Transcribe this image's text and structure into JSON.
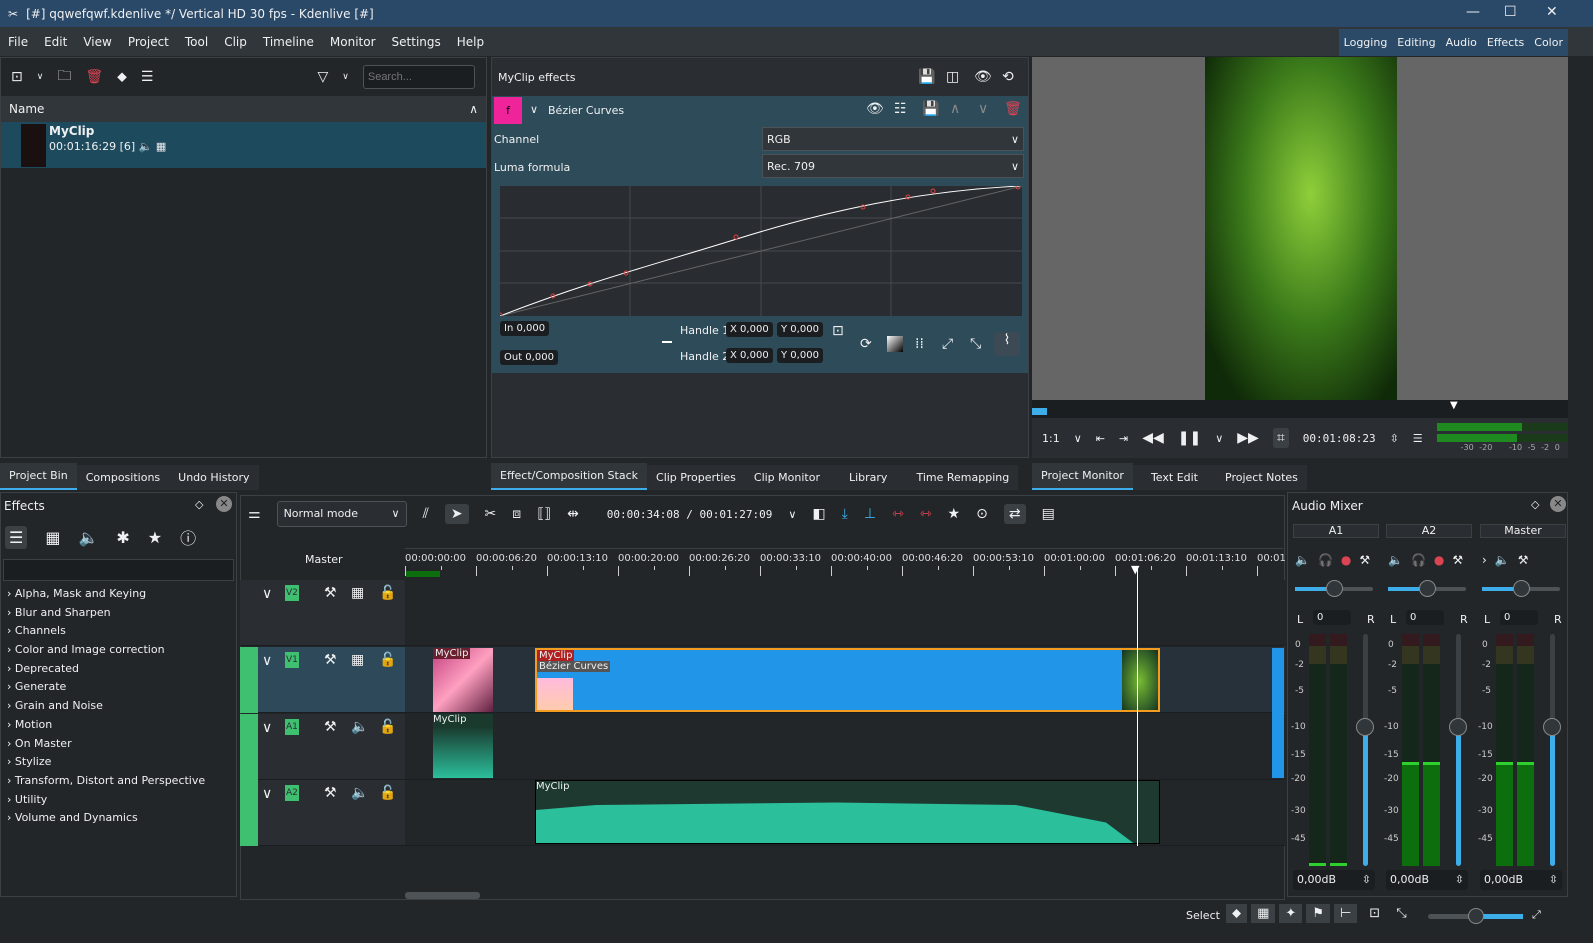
{
  "window": {
    "title": "[#] qqwefqwf.kdenlive */ Vertical HD 30 fps - Kdenlive [#]"
  },
  "menu": [
    "File",
    "Edit",
    "View",
    "Project",
    "Tool",
    "Clip",
    "Timeline",
    "Monitor",
    "Settings",
    "Help"
  ],
  "workspaces": [
    "Logging",
    "Editing",
    "Audio",
    "Effects",
    "Color"
  ],
  "bin": {
    "search_placeholder": "Search...",
    "column": "Name",
    "clip_name": "MyClip",
    "clip_info": "00:01:16:29 [6]"
  },
  "left_tabs": [
    "Project Bin",
    "Compositions",
    "Undo History"
  ],
  "effect_stack": {
    "title": "MyClip effects",
    "effect_name": "Bézier Curves",
    "channel_label": "Channel",
    "channel_value": "RGB",
    "luma_label": "Luma formula",
    "luma_value": "Rec. 709",
    "in": "In 0,000",
    "out": "Out 0,000",
    "handle1": "Handle 1:",
    "handle2": "Handle 2:",
    "x": "X",
    "y": "Y",
    "h1x": "0,000",
    "h1y": "0,000",
    "h2x": "0,000",
    "h2y": "0,000",
    "badge": "f"
  },
  "middle_tabs": [
    "Effect/Composition Stack",
    "Clip Properties",
    "Clip Monitor",
    "Library",
    "Time Remapping"
  ],
  "monitor": {
    "zoom": "1:1",
    "timecode": "00:01:08:23",
    "meter_scale": [
      "-30",
      "-20",
      "-10",
      "-5",
      "-2",
      "0"
    ]
  },
  "right_tabs": [
    "Project Monitor",
    "Text Edit",
    "Project Notes"
  ],
  "effects_panel": {
    "title": "Effects",
    "categories": [
      "Alpha, Mask and Keying",
      "Blur and Sharpen",
      "Channels",
      "Color and Image correction",
      "Deprecated",
      "Generate",
      "Grain and Noise",
      "Motion",
      "On Master",
      "Stylize",
      "Transform, Distort and Perspective",
      "Utility",
      "Volume and Dynamics"
    ]
  },
  "timeline": {
    "mode": "Normal mode",
    "position": "00:00:34:08 / 00:01:27:09",
    "master": "Master",
    "ruler": [
      "00:00:00:00",
      "00:00:06:20",
      "00:00:13:10",
      "00:00:20:00",
      "00:00:26:20",
      "00:00:33:10",
      "00:00:40:00",
      "00:00:46:20",
      "00:00:53:10",
      "00:01:00:00",
      "00:01:06:20",
      "00:01:13:10",
      "00:01"
    ],
    "tracks": [
      "V2",
      "V1",
      "A1",
      "A2"
    ],
    "clip": "MyClip",
    "clip_effect": "Bézier Curves"
  },
  "mixer": {
    "title": "Audio Mixer",
    "channels": [
      {
        "name": "A1",
        "pan": "0",
        "gain": "0,00dB"
      },
      {
        "name": "A2",
        "pan": "0",
        "gain": "0,00dB"
      },
      {
        "name": "Master",
        "pan": "0",
        "gain": "0,00dB"
      }
    ],
    "L": "L",
    "R": "R",
    "scale": [
      "0",
      "-2",
      "-5",
      "-10",
      "-15",
      "-20",
      "-30",
      "-45"
    ]
  },
  "status": {
    "tool": "Select"
  },
  "colors": {
    "accent": "#3daee9",
    "clip_video": "#2196e8",
    "clip_audio": "#2bbf9b",
    "effect_badge": "#f0249a"
  }
}
